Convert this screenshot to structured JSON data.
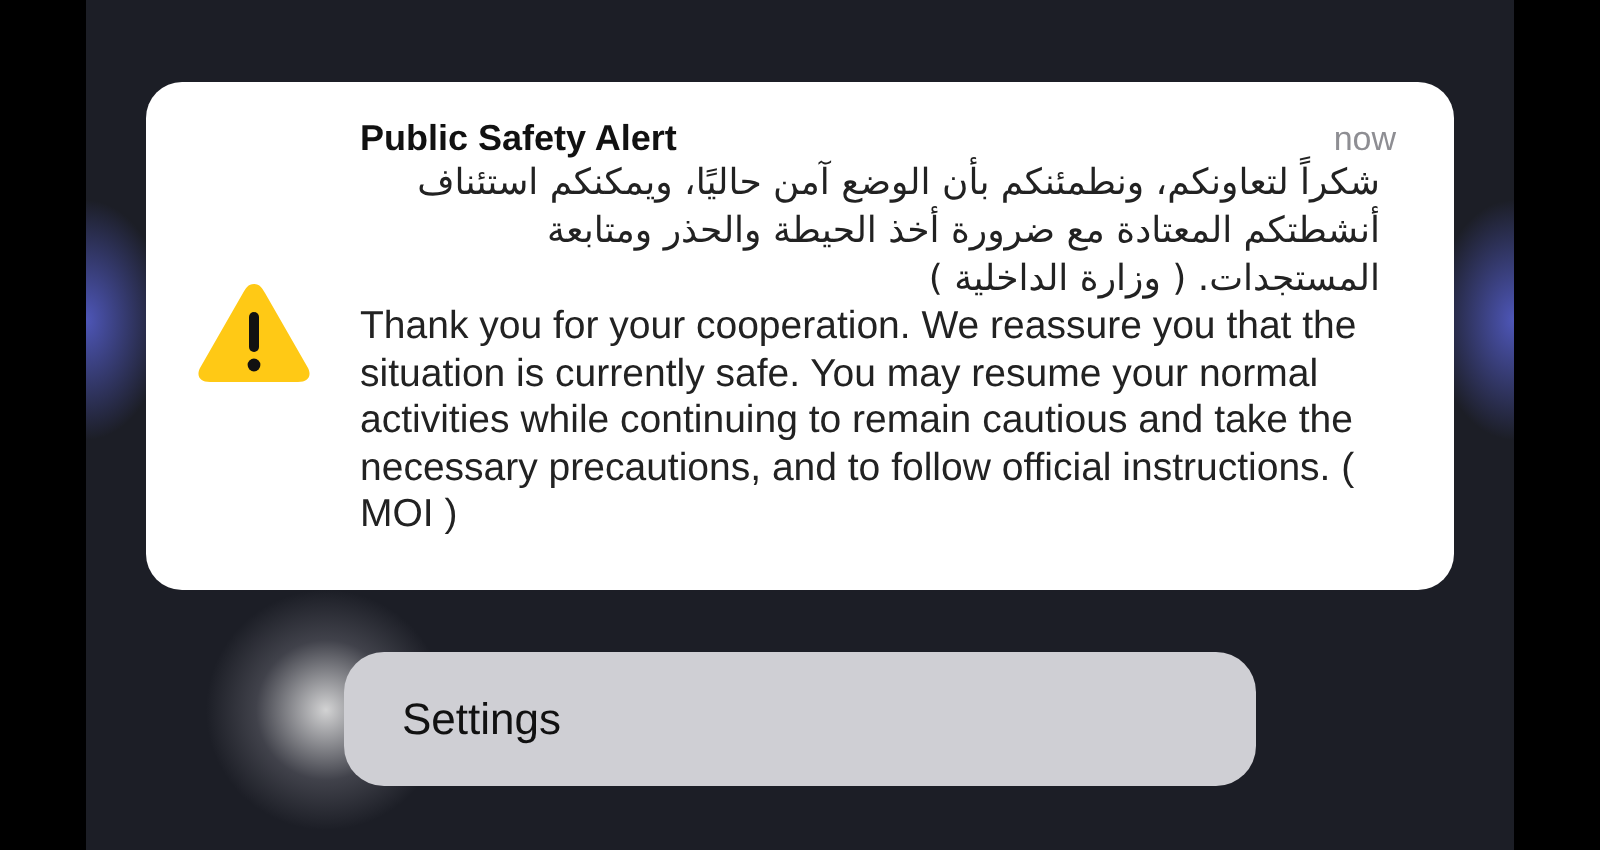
{
  "notification": {
    "title": "Public Safety Alert",
    "time": "now",
    "body": [
      {
        "kind": "arabic",
        "text": "شكراً لتعاونكم، ونطمئنكم بأن الوضع آمن حاليًا، ويمكنكم استئناف أنشطتكم المعتادة مع ضرورة أخذ الحيطة والحذر ومتابعة المستجدات. ( وزارة الداخلية )"
      },
      {
        "kind": "english",
        "text": "Thank you for your cooperation. We reassure you that the situation is currently safe. You may resume your normal activities while continuing to remain cautious and take the necessary precautions, and to follow official instructions. ( MOI  )"
      }
    ]
  },
  "actions": [
    {
      "label": "Settings"
    }
  ]
}
